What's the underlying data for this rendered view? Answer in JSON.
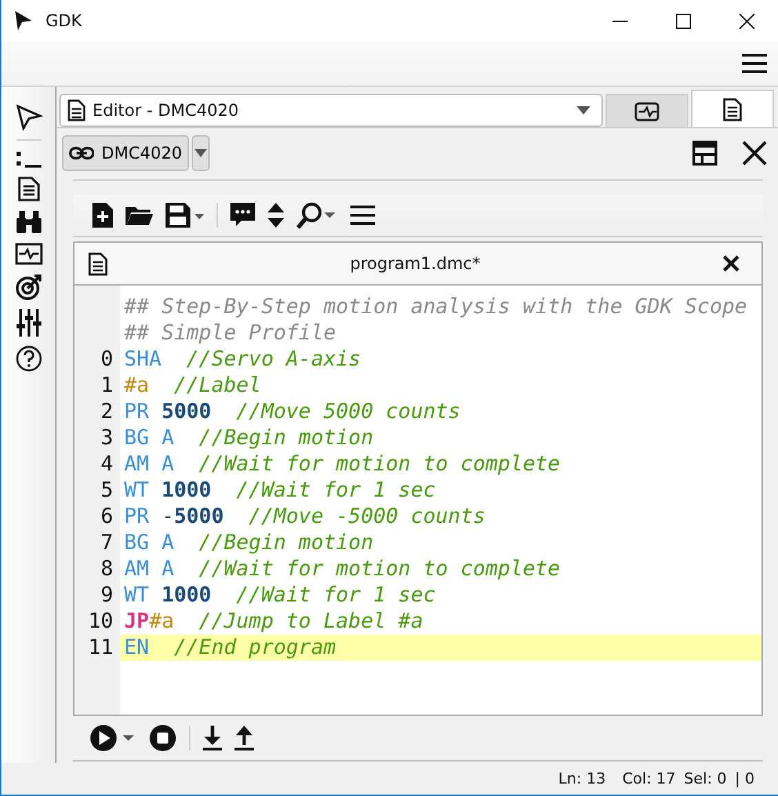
{
  "window": {
    "title": "GDK"
  },
  "view_selector": {
    "value": "Editor - DMC4020"
  },
  "view_tabs": [
    {
      "kind": "scope",
      "selected": false
    },
    {
      "kind": "document",
      "selected": true
    }
  ],
  "connection": {
    "label": "DMC4020"
  },
  "editor": {
    "tab_title": "program1.dmc*",
    "lines": [
      {
        "current": false,
        "tokens": [
          {
            "kind": "header",
            "text": "## Step-By-Step motion analysis with the GDK Scope"
          }
        ]
      },
      {
        "current": false,
        "tokens": [
          {
            "kind": "header",
            "text": "## Simple Profile"
          }
        ]
      },
      {
        "number": "0",
        "current": false,
        "tokens": [
          {
            "kind": "command",
            "text": "SHA"
          },
          {
            "kind": "comment",
            "text": "  //Servo A-axis"
          }
        ]
      },
      {
        "number": "1",
        "current": false,
        "tokens": [
          {
            "kind": "label",
            "text": "#a"
          },
          {
            "kind": "comment",
            "text": "  //Label"
          }
        ]
      },
      {
        "number": "2",
        "current": false,
        "tokens": [
          {
            "kind": "command",
            "text": "PR"
          },
          {
            "kind": "number",
            "text": " 5000"
          },
          {
            "kind": "comment",
            "text": "  //Move 5000 counts"
          }
        ]
      },
      {
        "number": "3",
        "current": false,
        "tokens": [
          {
            "kind": "command",
            "text": "BG A"
          },
          {
            "kind": "comment",
            "text": "  //Begin motion"
          }
        ]
      },
      {
        "number": "4",
        "current": false,
        "tokens": [
          {
            "kind": "command",
            "text": "AM A"
          },
          {
            "kind": "comment",
            "text": "  //Wait for motion to complete"
          }
        ]
      },
      {
        "number": "5",
        "current": false,
        "tokens": [
          {
            "kind": "command",
            "text": "WT"
          },
          {
            "kind": "number",
            "text": " 1000"
          },
          {
            "kind": "comment",
            "text": "  //Wait for 1 sec"
          }
        ]
      },
      {
        "number": "6",
        "current": false,
        "tokens": [
          {
            "kind": "command",
            "text": "PR"
          },
          {
            "kind": "plain",
            "text": " -"
          },
          {
            "kind": "number",
            "text": "5000"
          },
          {
            "kind": "comment",
            "text": "  //Move -5000 counts"
          }
        ]
      },
      {
        "number": "7",
        "current": false,
        "tokens": [
          {
            "kind": "command",
            "text": "BG A"
          },
          {
            "kind": "comment",
            "text": "  //Begin motion"
          }
        ]
      },
      {
        "number": "8",
        "current": false,
        "tokens": [
          {
            "kind": "command",
            "text": "AM A"
          },
          {
            "kind": "comment",
            "text": "  //Wait for motion to complete"
          }
        ]
      },
      {
        "number": "9",
        "current": false,
        "tokens": [
          {
            "kind": "command",
            "text": "WT"
          },
          {
            "kind": "number",
            "text": " 1000"
          },
          {
            "kind": "comment",
            "text": "  //Wait for 1 sec"
          }
        ]
      },
      {
        "number": "10",
        "current": false,
        "tokens": [
          {
            "kind": "jump",
            "text": "JP"
          },
          {
            "kind": "label",
            "text": "#a"
          },
          {
            "kind": "comment",
            "text": "  //Jump to Label #a"
          }
        ]
      },
      {
        "number": "11",
        "current": true,
        "tokens": [
          {
            "kind": "command",
            "text": "EN"
          },
          {
            "kind": "comment",
            "text": "  //End program"
          }
        ]
      }
    ]
  },
  "status_bar": [
    "Ln: 13",
    "Col: 17",
    "Sel: 0",
    "| 0"
  ]
}
